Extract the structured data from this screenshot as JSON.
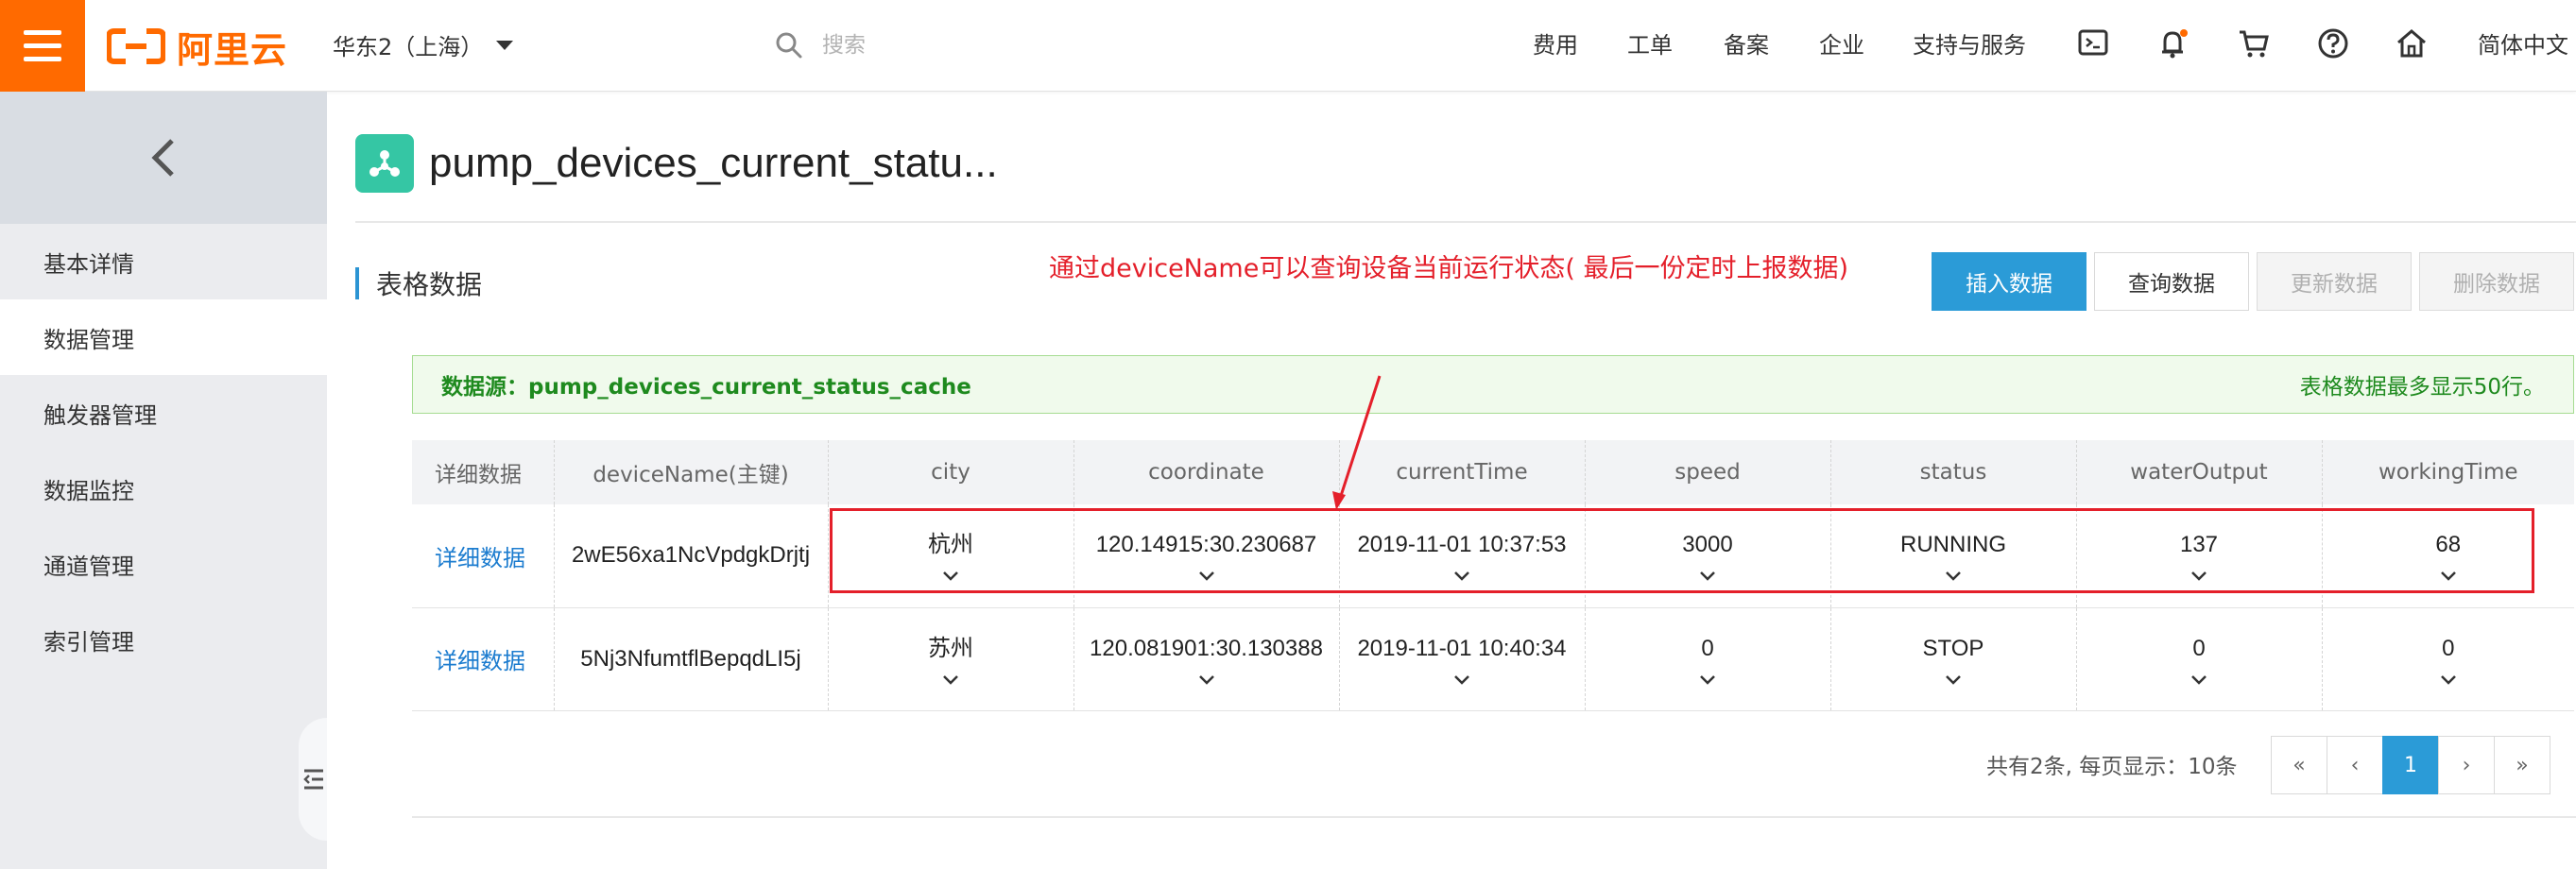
{
  "topbar": {
    "logo_text": "阿里云",
    "region": "华东2（上海）",
    "search_placeholder": "搜索",
    "nav": [
      "费用",
      "工单",
      "备案",
      "企业",
      "支持与服务"
    ],
    "language": "简体中文"
  },
  "sidebar": {
    "items": [
      {
        "label": "基本详情",
        "active": false
      },
      {
        "label": "数据管理",
        "active": true
      },
      {
        "label": "触发器管理",
        "active": false
      },
      {
        "label": "数据监控",
        "active": false
      },
      {
        "label": "通道管理",
        "active": false
      },
      {
        "label": "索引管理",
        "active": false
      }
    ]
  },
  "main": {
    "title": "pump_devices_current_statu...",
    "section_title": "表格数据",
    "buttons": {
      "insert": "插入数据",
      "query": "查询数据",
      "update": "更新数据",
      "delete": "删除数据"
    },
    "notice": {
      "source": "数据源：pump_devices_current_status_cache",
      "limit": "表格数据最多显示50行。"
    },
    "annotation": "通过deviceName可以查询设备当前运行状态( 最后一份定时上报数据)",
    "table": {
      "columns": [
        "详细数据",
        "deviceName(主键)",
        "city",
        "coordinate",
        "currentTime",
        "speed",
        "status",
        "waterOutput",
        "workingTime"
      ],
      "rows": [
        {
          "detail": "详细数据",
          "deviceName": "2wE56xa1NcVpdgkDrjtj",
          "city": "杭州",
          "coordinate": "120.14915:30.230687",
          "currentTime": "2019-11-01 10:37:53",
          "speed": "3000",
          "status": "RUNNING",
          "waterOutput": "137",
          "workingTime": "68"
        },
        {
          "detail": "详细数据",
          "deviceName": "5Nj3NfumtflBepqdLI5j",
          "city": "苏州",
          "coordinate": "120.081901:30.130388",
          "currentTime": "2019-11-01 10:40:34",
          "speed": "0",
          "status": "STOP",
          "waterOutput": "0",
          "workingTime": "0"
        }
      ]
    },
    "pagination": {
      "info": "共有2条, 每页显示：10条",
      "first": "«",
      "prev": "‹",
      "current": "1",
      "next": "›",
      "last": "»"
    }
  },
  "colors": {
    "brand": "#ff6a00",
    "primary": "#2b9bd7",
    "link": "#1c7ccf",
    "annotation": "#e41f2a",
    "notice_text": "#1e8a1e"
  }
}
